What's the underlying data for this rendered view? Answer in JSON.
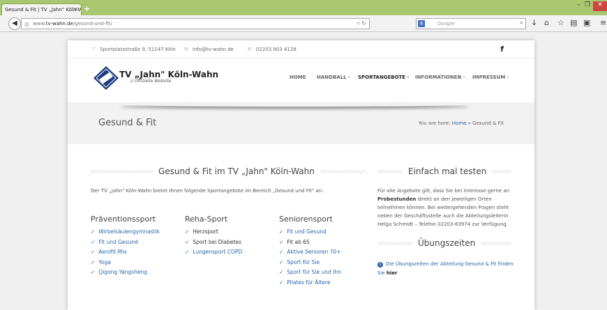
{
  "browser": {
    "tab_title": "Gesund & Fit | TV „Jahn\" Köln-Wahn",
    "new_tab": "+",
    "url_prefix": "www.",
    "url_domain": "tv-wahn.de",
    "url_path": "/gesund-und-fit/",
    "search_placeholder": "Google",
    "search_engine": "8"
  },
  "topbar": {
    "address": "Sportplatzstraße 9, 51147 Köln",
    "email": "info@tv-wahn.de",
    "phone": "02203 903 4128",
    "social": "f"
  },
  "brand": {
    "title": "TV „Jahn\" Köln-Wahn",
    "subtitle": "// Offizielle Website"
  },
  "menu": [
    {
      "label": "HOME"
    },
    {
      "label": "HANDBALL ·"
    },
    {
      "label": "SPORTANGEBOTE ·"
    },
    {
      "label": "INFORMATIONEN ·"
    },
    {
      "label": "IMPRESSUM ·"
    }
  ],
  "page_header": {
    "title": "Gesund & Fit",
    "breadcrumb_prefix": "You are here: ",
    "breadcrumb_home": "Home",
    "breadcrumb_current": " » Gesund & Fit"
  },
  "main": {
    "heading": "Gesund & Fit im TV „Jahn\" Köln-Wahn",
    "intro": "Der TV „Jahn\" Köln-Wahn bietet Ihnen folgende Sportangebote im Bereich „Gesund und Fit\" an:",
    "columns": [
      {
        "title": "Präventionssport",
        "items": [
          {
            "label": "Wirbelsäulengymnastik",
            "link": true
          },
          {
            "label": "Fit und Gesund",
            "link": true
          },
          {
            "label": "Aerofit-Mix",
            "link": true
          },
          {
            "label": "Yoga",
            "link": true
          },
          {
            "label": "Qigong Yangsheng",
            "link": true
          }
        ]
      },
      {
        "title": "Reha-Sport",
        "items": [
          {
            "label": "Herzsport",
            "link": false
          },
          {
            "label": "Sport bei Diabetes",
            "link": false
          },
          {
            "label": "Lungensport COPD",
            "link": true
          }
        ]
      },
      {
        "title": "Seniorensport",
        "items": [
          {
            "label": "Fit und Gesund",
            "link": true
          },
          {
            "label": "Fit ab 65",
            "link": false
          },
          {
            "label": "Aktive Senioren 70+",
            "link": true
          },
          {
            "label": "Sport für Sie",
            "link": true
          },
          {
            "label": "Sport für Sie und Ihn",
            "link": true
          },
          {
            "label": "Pilates für Ältere",
            "link": true
          }
        ]
      }
    ]
  },
  "sidebar": {
    "heading1": "Einfach mal testen",
    "para_before": "Für alle Angebote gilt, dass Sie bei Interesse gerne an ",
    "para_bold": "Probestunden",
    "para_after": " direkt an den jeweiligen Orten teilnehmen können. Bei weitergehenden Fragen steht neben der Geschäftsstelle auch die Abteilungsleiterin Helga Schmidt – Telefon 02203-63974 zur Verfügung.",
    "heading2": "Übungszeiten",
    "note_text": "Die Übungszeiten der Abteilung Gesund & Fit finden Sie ",
    "note_link": "hier"
  }
}
